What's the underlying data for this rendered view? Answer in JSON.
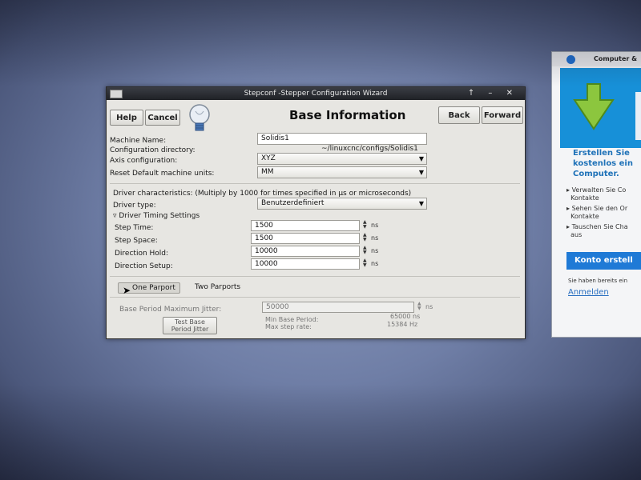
{
  "window": {
    "title": "Stepconf -Stepper Configuration Wizard",
    "controls": "↑ – ✕"
  },
  "toolbar": {
    "help_label": "Help",
    "cancel_label": "Cancel",
    "heading": "Base Information",
    "back_label": "Back",
    "forward_label": "Forward"
  },
  "form": {
    "machine_name_label": "Machine Name:",
    "machine_name_value": "Solidis1",
    "config_dir_label": "Configuration directory:",
    "config_dir_value": "~/linuxcnc/configs/Solidis1",
    "axis_label": "Axis configuration:",
    "axis_value": "XYZ",
    "units_label": "Reset Default machine units:",
    "units_value": "MM",
    "driver_char_label": "Driver characteristics: (Multiply by 1000 for times specified in µs or microseconds)",
    "driver_type_label": "Driver type:",
    "driver_type_value": "Benutzerdefiniert",
    "timing_expander": "Driver Timing Settings",
    "step_time_label": "Step Time:",
    "step_time_value": "1500",
    "step_space_label": "Step Space:",
    "step_space_value": "1500",
    "dir_hold_label": "Direction Hold:",
    "dir_hold_value": "10000",
    "dir_setup_label": "Direction Setup:",
    "dir_setup_value": "10000",
    "unit_ns": "ns",
    "one_parport": "One Parport",
    "two_parports": "Two Parports",
    "jitter_label": "Base Period Maximum Jitter:",
    "jitter_value": "50000",
    "test_button_line1": "Test Base",
    "test_button_line2": "Period Jitter",
    "min_base_label": "Min Base Period:",
    "min_base_value": "65000 ns",
    "max_step_label": "Max step rate:",
    "max_step_value": "15384 Hz"
  },
  "side_window": {
    "title": "Computer &",
    "headline1": "Erstellen Sie",
    "headline2": "kostenlos ein",
    "headline3": "Computer.",
    "item1_line1": "Verwalten Sie Co",
    "item1_line2": "Kontakte",
    "item2_line1": "Sehen Sie den Or",
    "item2_line2": "Kontakte",
    "item3_line1": "Tauschen Sie Cha",
    "item3_line2": "aus",
    "button": "Konto erstell",
    "note": "Sie haben bereits ein",
    "link": "Anmelden",
    "accent": "#1790d8"
  }
}
